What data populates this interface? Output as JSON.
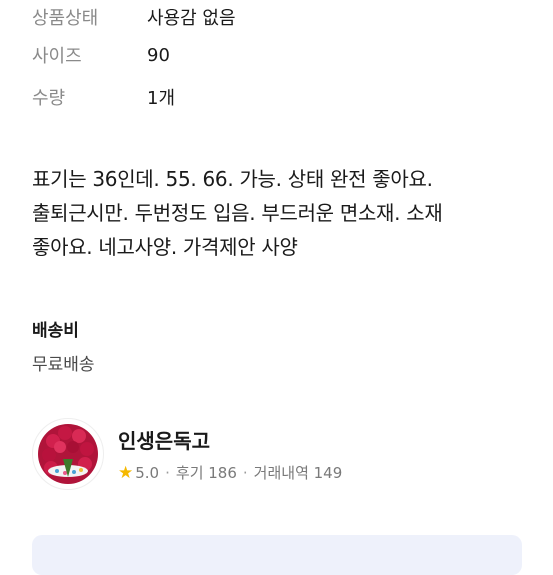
{
  "specs": [
    {
      "label": "상품상태",
      "value": "사용감 없음"
    },
    {
      "label": "사이즈",
      "value": "90"
    },
    {
      "label": "수량",
      "value": "1개"
    }
  ],
  "description": {
    "lines": [
      "표기는 36인데. 55. 66. 가능. 상태 완전 좋아요.",
      "출퇴근시만. 두번정도 입음.  부드러운 면소재. 소재",
      "좋아요. 네고사양. 가격제안 사양"
    ]
  },
  "shipping": {
    "title": "배송비",
    "value": "무료배송"
  },
  "seller": {
    "name": "인생은독고",
    "star_icon": "star-icon",
    "rating": "5.0",
    "reviews": "후기 186",
    "transactions": "거래내역 149",
    "separator": "·"
  },
  "colors": {
    "star": "#f5b800",
    "card_bg": "#eef1fb",
    "label_gray": "#8a8a8a"
  }
}
